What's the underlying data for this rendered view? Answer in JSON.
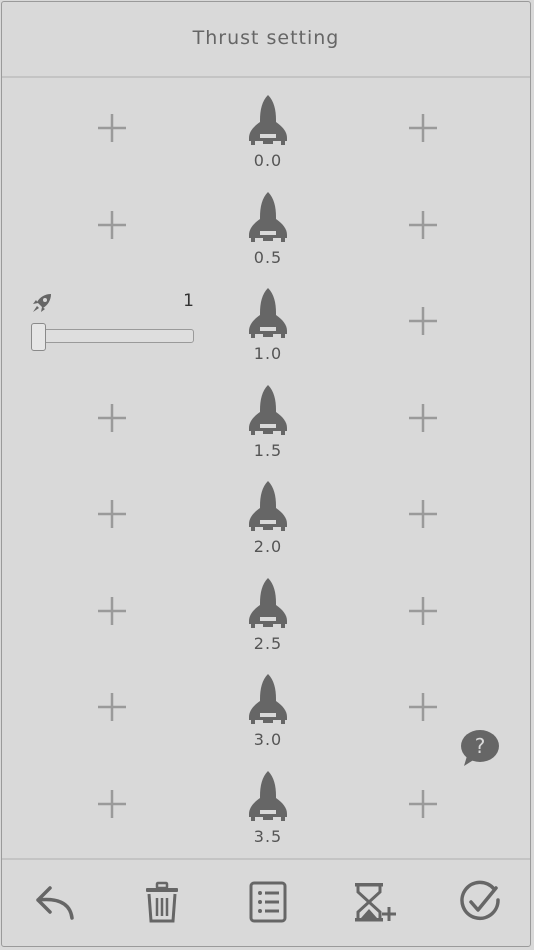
{
  "header": {
    "title": "Thrust setting"
  },
  "rows": [
    {
      "value": "0.0",
      "editing": false
    },
    {
      "value": "0.5",
      "editing": false
    },
    {
      "value": "1.0",
      "editing": true
    },
    {
      "value": "1.5",
      "editing": false
    },
    {
      "value": "2.0",
      "editing": false
    },
    {
      "value": "2.5",
      "editing": false
    },
    {
      "value": "3.0",
      "editing": false
    },
    {
      "value": "3.5",
      "editing": false
    }
  ],
  "editor": {
    "count": "1",
    "slider_fraction": 0.0
  },
  "icons": {
    "rocket": "rocket-icon",
    "plus": "plus-icon",
    "help": "help-bubble-icon",
    "footer": [
      "undo-icon",
      "trash-icon",
      "list-icon",
      "hourglass-add-icon",
      "check-circle-icon"
    ]
  },
  "colors": {
    "icon": "#666666",
    "plus": "#9a9a9a",
    "background": "#d9d9d9"
  }
}
